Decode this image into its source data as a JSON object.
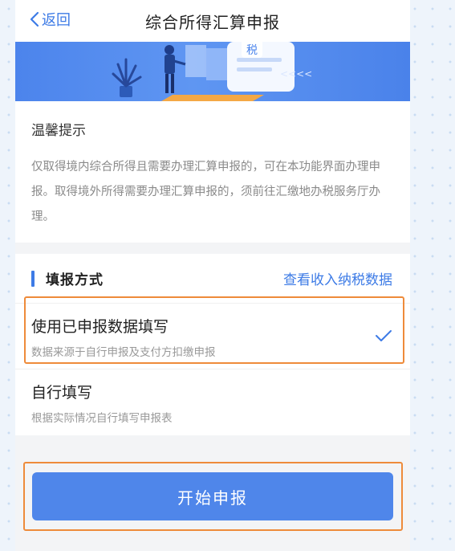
{
  "header": {
    "back_label": "返回",
    "title": "综合所得汇算申报"
  },
  "banner": {
    "tax_char": "税",
    "arrows": "<<<<"
  },
  "tips": {
    "title": "温馨提示",
    "body": "仅取得境内综合所得且需要办理汇算申报的，可在本功能界面办理申报。取得境外所得需要办理汇算申报的，须前往汇缴地办税服务厅办理。"
  },
  "fill_method": {
    "title": "填报方式",
    "link": "查看收入纳税数据",
    "options": [
      {
        "title": "使用已申报数据填写",
        "subtitle": "数据来源于自行申报及支付方扣缴申报",
        "selected": true
      },
      {
        "title": "自行填写",
        "subtitle": "根据实际情况自行填写申报表",
        "selected": false
      }
    ]
  },
  "actions": {
    "start_label": "开始申报"
  },
  "colors": {
    "accent": "#3d7be6",
    "button": "#4f86ea",
    "highlight": "#ee8b3a"
  }
}
